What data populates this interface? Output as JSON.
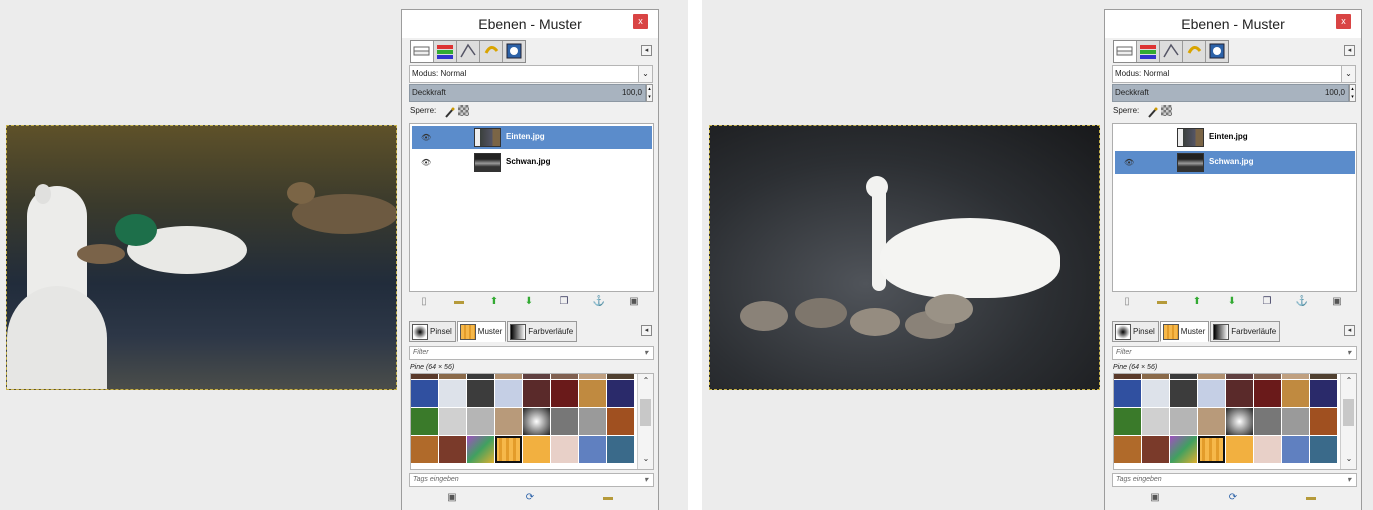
{
  "windows": [
    {
      "title": "Ebenen - Muster",
      "close_label": "x",
      "modus_label": "Modus: Normal",
      "deckkraft_label": "Deckkraft",
      "deckkraft_value": "100,0",
      "sperre_label": "Sperre:",
      "layers": [
        {
          "name": "Einten.jpg",
          "visible": true,
          "selected": true
        },
        {
          "name": "Schwan.jpg",
          "visible": true,
          "selected": false
        }
      ],
      "dock_tabs": [
        "Pinsel",
        "Muster",
        "Farbverläufe"
      ],
      "filter_placeholder": "Filter",
      "pattern_info": "Pine (64 × 56)",
      "tags_placeholder": "Tags eingeben"
    },
    {
      "title": "Ebenen - Muster",
      "close_label": "x",
      "modus_label": "Modus: Normal",
      "deckkraft_label": "Deckkraft",
      "deckkraft_value": "100,0",
      "sperre_label": "Sperre:",
      "layers": [
        {
          "name": "Einten.jpg",
          "visible": false,
          "selected": false
        },
        {
          "name": "Schwan.jpg",
          "visible": true,
          "selected": true
        }
      ],
      "dock_tabs": [
        "Pinsel",
        "Muster",
        "Farbverläufe"
      ],
      "filter_placeholder": "Filter",
      "pattern_info": "Pine (64 × 56)",
      "tags_placeholder": "Tags eingeben"
    }
  ],
  "colors": {
    "selection": "#5b8ccb",
    "close_button": "#d94444",
    "opacity_bar": "#a8b3bf"
  },
  "icons": [
    "new-layer-icon",
    "new-group-icon",
    "raise-layer-icon",
    "lower-layer-icon",
    "duplicate-layer-icon",
    "anchor-icon",
    "delete-icon",
    "refresh-icon",
    "open-folder-icon"
  ]
}
